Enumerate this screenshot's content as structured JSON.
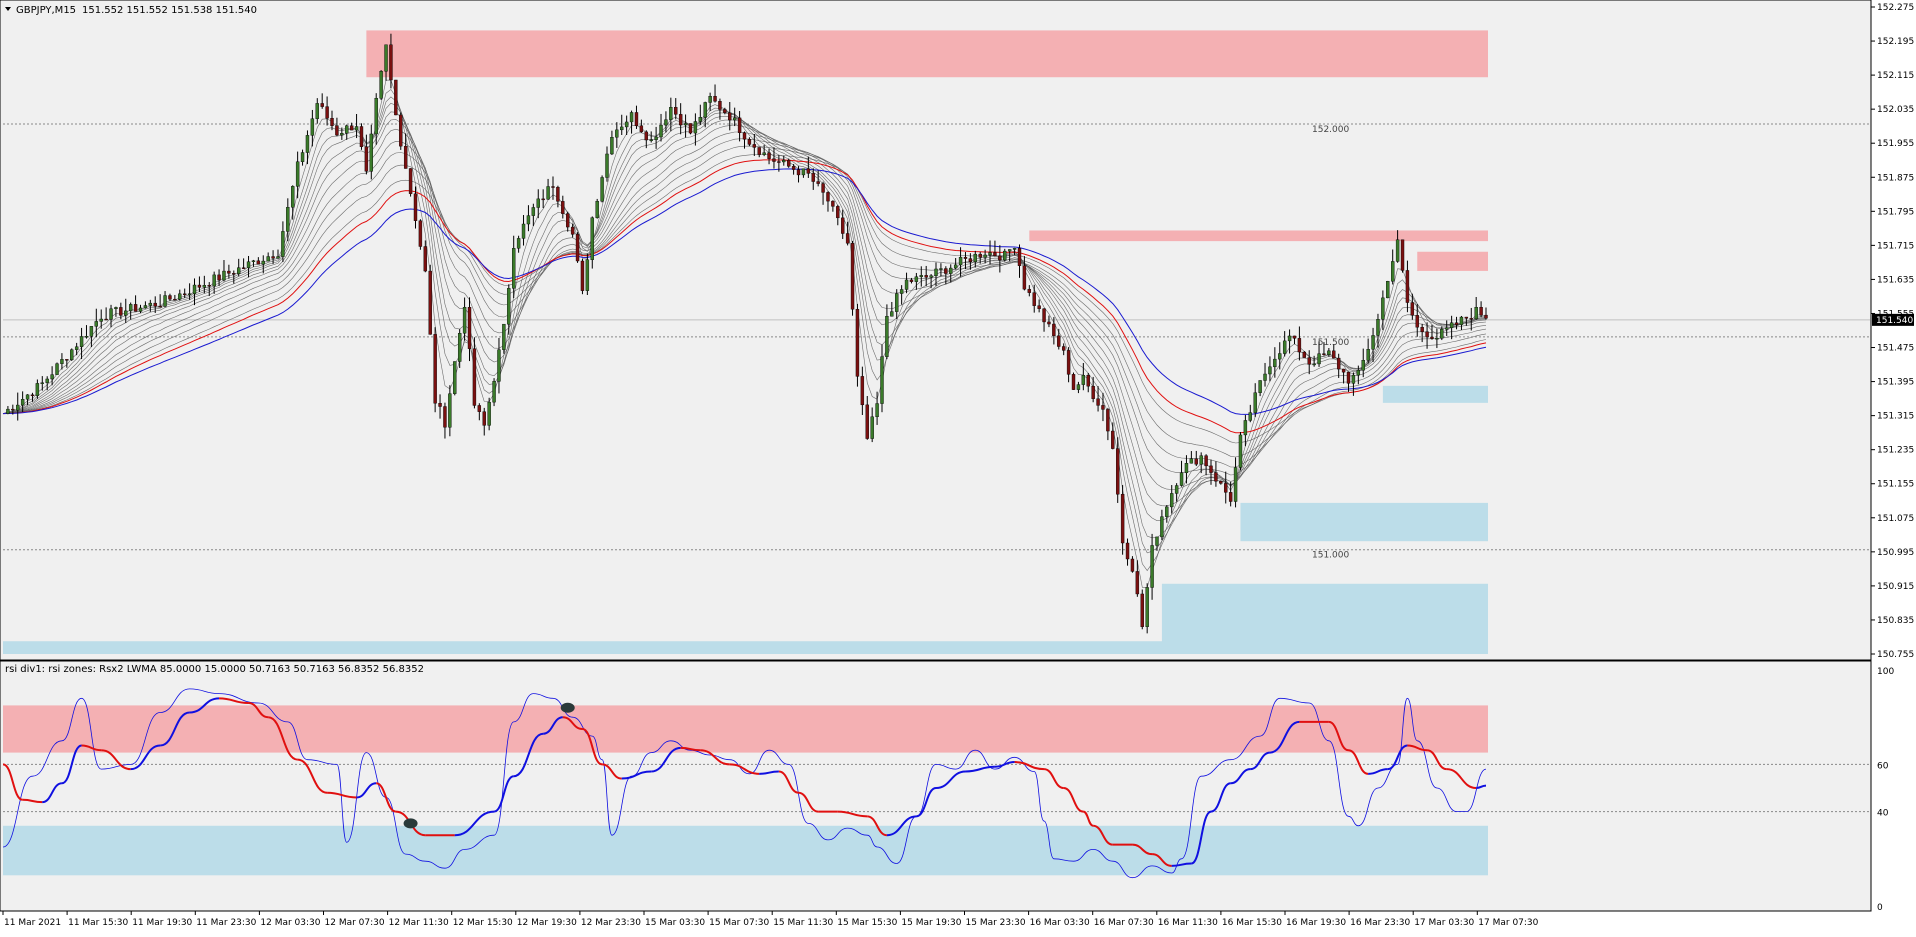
{
  "window": {
    "symbol_label": "GBPJPY,M15",
    "ohlc": "151.552 151.552 151.538 151.540"
  },
  "colors": {
    "background": "#f0f0f0",
    "supply_zone": "#f4b0b3",
    "demand_zone": "#bcdde9",
    "ema_red": "#e01010",
    "ema_blue": "#1a1ad0",
    "ema_gray": "#555555",
    "bull_candle": "#3a7a2a",
    "bear_candle": "#7a1010",
    "rsi_fast": "#1010e0",
    "rsi_slow_red": "#e01010"
  },
  "chart_data": [
    {
      "type": "candlestick",
      "title": "GBPJPY,M15",
      "ylim": [
        150.755,
        152.275
      ],
      "price_ticks": [
        "152.275",
        "152.195",
        "152.115",
        "152.035",
        "151.955",
        "151.875",
        "151.795",
        "151.715",
        "151.635",
        "151.555",
        "151.475",
        "151.395",
        "151.315",
        "151.235",
        "151.155",
        "151.075",
        "150.995",
        "150.915",
        "150.835",
        "150.755"
      ],
      "current_price": "151.540",
      "round_levels": [
        {
          "price": 152.0,
          "label": "152.000"
        },
        {
          "price": 151.5,
          "label": "151.500"
        },
        {
          "price": 151.0,
          "label": "151.000"
        }
      ],
      "time_labels": [
        "11 Mar 2021",
        "11 Mar 15:30",
        "11 Mar 19:30",
        "11 Mar 23:30",
        "12 Mar 03:30",
        "12 Mar 07:30",
        "12 Mar 11:30",
        "12 Mar 15:30",
        "12 Mar 19:30",
        "12 Mar 23:30",
        "15 Mar 03:30",
        "15 Mar 07:30",
        "15 Mar 11:30",
        "15 Mar 15:30",
        "15 Mar 19:30",
        "15 Mar 23:30",
        "16 Mar 03:30",
        "16 Mar 07:30",
        "16 Mar 11:30",
        "16 Mar 15:30",
        "16 Mar 19:30",
        "16 Mar 23:30",
        "17 Mar 03:30",
        "17 Mar 07:30"
      ],
      "close_path": [
        [
          0,
          151.32
        ],
        [
          8,
          151.39
        ],
        [
          20,
          151.55
        ],
        [
          32,
          151.58
        ],
        [
          44,
          151.64
        ],
        [
          56,
          151.7
        ],
        [
          60,
          151.9
        ],
        [
          64,
          152.05
        ],
        [
          68,
          151.98
        ],
        [
          72,
          152.0
        ],
        [
          74,
          151.88
        ],
        [
          76,
          152.05
        ],
        [
          78,
          152.18
        ],
        [
          80,
          152.02
        ],
        [
          84,
          151.78
        ],
        [
          86,
          151.65
        ],
        [
          88,
          151.35
        ],
        [
          90,
          151.3
        ],
        [
          94,
          151.58
        ],
        [
          96,
          151.34
        ],
        [
          98,
          151.29
        ],
        [
          102,
          151.52
        ],
        [
          104,
          151.72
        ],
        [
          108,
          151.8
        ],
        [
          112,
          151.86
        ],
        [
          116,
          151.74
        ],
        [
          118,
          151.6
        ],
        [
          120,
          151.78
        ],
        [
          124,
          151.98
        ],
        [
          128,
          152.02
        ],
        [
          132,
          151.96
        ],
        [
          136,
          152.04
        ],
        [
          140,
          151.98
        ],
        [
          144,
          152.06
        ],
        [
          148,
          152.02
        ],
        [
          152,
          151.96
        ],
        [
          156,
          151.92
        ],
        [
          160,
          151.9
        ],
        [
          164,
          151.88
        ],
        [
          168,
          151.82
        ],
        [
          172,
          151.72
        ],
        [
          174,
          151.4
        ],
        [
          176,
          151.26
        ],
        [
          178,
          151.34
        ],
        [
          180,
          151.55
        ],
        [
          184,
          151.63
        ],
        [
          188,
          151.64
        ],
        [
          192,
          151.66
        ],
        [
          196,
          151.68
        ],
        [
          200,
          151.7
        ],
        [
          204,
          151.69
        ],
        [
          206,
          151.72
        ],
        [
          208,
          151.62
        ],
        [
          212,
          151.54
        ],
        [
          216,
          151.46
        ],
        [
          218,
          151.38
        ],
        [
          220,
          151.4
        ],
        [
          224,
          151.33
        ],
        [
          226,
          151.24
        ],
        [
          228,
          151.02
        ],
        [
          230,
          150.96
        ],
        [
          232,
          150.82
        ],
        [
          234,
          151.0
        ],
        [
          236,
          151.08
        ],
        [
          240,
          151.19
        ],
        [
          244,
          151.22
        ],
        [
          248,
          151.15
        ],
        [
          250,
          151.12
        ],
        [
          252,
          151.26
        ],
        [
          256,
          151.39
        ],
        [
          258,
          151.44
        ],
        [
          262,
          151.5
        ],
        [
          266,
          151.44
        ],
        [
          270,
          151.46
        ],
        [
          274,
          151.4
        ],
        [
          276,
          151.41
        ],
        [
          280,
          151.54
        ],
        [
          282,
          151.64
        ],
        [
          284,
          151.72
        ],
        [
          286,
          151.58
        ],
        [
          288,
          151.52
        ],
        [
          292,
          151.5
        ],
        [
          296,
          151.53
        ],
        [
          300,
          151.56
        ],
        [
          302,
          151.55
        ]
      ],
      "ema_fan": {
        "count": 11,
        "periods": "3 to 60"
      },
      "zones": [
        {
          "kind": "supply",
          "from": 74,
          "to": 302,
          "low": 152.11,
          "high": 152.22
        },
        {
          "kind": "supply",
          "from": 209,
          "to": 302,
          "low": 151.725,
          "high": 151.75
        },
        {
          "kind": "supply",
          "from": 288,
          "to": 302,
          "low": 151.655,
          "high": 151.7
        },
        {
          "kind": "demand",
          "from": 281,
          "to": 302,
          "low": 151.345,
          "high": 151.385
        },
        {
          "kind": "demand",
          "from": 252,
          "to": 302,
          "low": 151.02,
          "high": 151.11
        },
        {
          "kind": "demand",
          "from": 236,
          "to": 302,
          "low": 150.755,
          "high": 150.92
        },
        {
          "kind": "demand",
          "from": 0,
          "to": 236,
          "low": 150.755,
          "high": 150.785
        }
      ]
    },
    {
      "type": "line",
      "title": "rsi div1: rsi zones: Rsx2 LWMA 85.0000 15.0000 50.7163 50.7163 56.8352 56.8352",
      "ylim": [
        0,
        100
      ],
      "ticks": [
        "100",
        "60",
        "40",
        "0"
      ],
      "levels": [
        60,
        40
      ],
      "zones": [
        {
          "kind": "overbought",
          "low": 65,
          "high": 85
        },
        {
          "kind": "oversold",
          "low": 13,
          "high": 34
        }
      ],
      "series": [
        {
          "kind": "fast",
          "points": [
            [
              0,
              25
            ],
            [
              6,
              55
            ],
            [
              12,
              70
            ],
            [
              16,
              88
            ],
            [
              20,
              58
            ],
            [
              26,
              60
            ],
            [
              32,
              82
            ],
            [
              38,
              92
            ],
            [
              44,
              90
            ],
            [
              52,
              86
            ],
            [
              58,
              78
            ],
            [
              62,
              62
            ],
            [
              68,
              60
            ],
            [
              70,
              27
            ],
            [
              74,
              65
            ],
            [
              78,
              46
            ],
            [
              82,
              22
            ],
            [
              86,
              19
            ],
            [
              90,
              16
            ],
            [
              94,
              24
            ],
            [
              100,
              30
            ],
            [
              104,
              78
            ],
            [
              108,
              90
            ],
            [
              112,
              88
            ],
            [
              116,
              80
            ],
            [
              120,
              72
            ],
            [
              122,
              62
            ],
            [
              124,
              30
            ],
            [
              128,
              55
            ],
            [
              132,
              65
            ],
            [
              136,
              70
            ],
            [
              140,
              66
            ],
            [
              144,
              64
            ],
            [
              148,
              62
            ],
            [
              152,
              56
            ],
            [
              156,
              66
            ],
            [
              160,
              60
            ],
            [
              164,
              35
            ],
            [
              168,
              28
            ],
            [
              172,
              33
            ],
            [
              176,
              30
            ],
            [
              178,
              25
            ],
            [
              182,
              18
            ],
            [
              186,
              38
            ],
            [
              190,
              60
            ],
            [
              194,
              58
            ],
            [
              198,
              66
            ],
            [
              202,
              58
            ],
            [
              206,
              63
            ],
            [
              210,
              57
            ],
            [
              212,
              36
            ],
            [
              214,
              20
            ],
            [
              218,
              19
            ],
            [
              222,
              24
            ],
            [
              226,
              19
            ],
            [
              230,
              12
            ],
            [
              234,
              17
            ],
            [
              238,
              14
            ],
            [
              240,
              20
            ],
            [
              244,
              55
            ],
            [
              250,
              62
            ],
            [
              256,
              72
            ],
            [
              260,
              88
            ],
            [
              266,
              86
            ],
            [
              270,
              70
            ],
            [
              274,
              38
            ],
            [
              276,
              34
            ],
            [
              280,
              50
            ],
            [
              284,
              60
            ],
            [
              286,
              88
            ],
            [
              288,
              70
            ],
            [
              292,
              50
            ],
            [
              296,
              40
            ],
            [
              298,
              40
            ],
            [
              302,
              58
            ]
          ]
        },
        {
          "kind": "slow",
          "points": [
            [
              0,
              60
            ],
            [
              4,
              45
            ],
            [
              8,
              44
            ],
            [
              12,
              52
            ],
            [
              16,
              68
            ],
            [
              20,
              66
            ],
            [
              26,
              58
            ],
            [
              32,
              68
            ],
            [
              38,
              82
            ],
            [
              44,
              88
            ],
            [
              50,
              86
            ],
            [
              54,
              80
            ],
            [
              60,
              62
            ],
            [
              66,
              48
            ],
            [
              72,
              46
            ],
            [
              76,
              52
            ],
            [
              80,
              40
            ],
            [
              86,
              30
            ],
            [
              92,
              30
            ],
            [
              100,
              40
            ],
            [
              104,
              55
            ],
            [
              110,
              73
            ],
            [
              114,
              80
            ],
            [
              118,
              75
            ],
            [
              122,
              60
            ],
            [
              126,
              54
            ],
            [
              132,
              57
            ],
            [
              138,
              67
            ],
            [
              142,
              66
            ],
            [
              148,
              60
            ],
            [
              154,
              56
            ],
            [
              158,
              57
            ],
            [
              162,
              48
            ],
            [
              166,
              40
            ],
            [
              170,
              40
            ],
            [
              176,
              38
            ],
            [
              180,
              30
            ],
            [
              186,
              38
            ],
            [
              190,
              50
            ],
            [
              196,
              57
            ],
            [
              202,
              59
            ],
            [
              206,
              61
            ],
            [
              212,
              58
            ],
            [
              216,
              50
            ],
            [
              220,
              40
            ],
            [
              222,
              34
            ],
            [
              226,
              26
            ],
            [
              230,
              26
            ],
            [
              234,
              22
            ],
            [
              238,
              17
            ],
            [
              242,
              18
            ],
            [
              246,
              40
            ],
            [
              250,
              52
            ],
            [
              254,
              58
            ],
            [
              258,
              65
            ],
            [
              264,
              78
            ],
            [
              270,
              78
            ],
            [
              274,
              66
            ],
            [
              278,
              56
            ],
            [
              282,
              58
            ],
            [
              286,
              68
            ],
            [
              290,
              66
            ],
            [
              294,
              58
            ],
            [
              300,
              50
            ],
            [
              302,
              51
            ]
          ]
        }
      ],
      "divergence_markers": [
        [
          115,
          84
        ],
        [
          83,
          35
        ]
      ]
    }
  ]
}
